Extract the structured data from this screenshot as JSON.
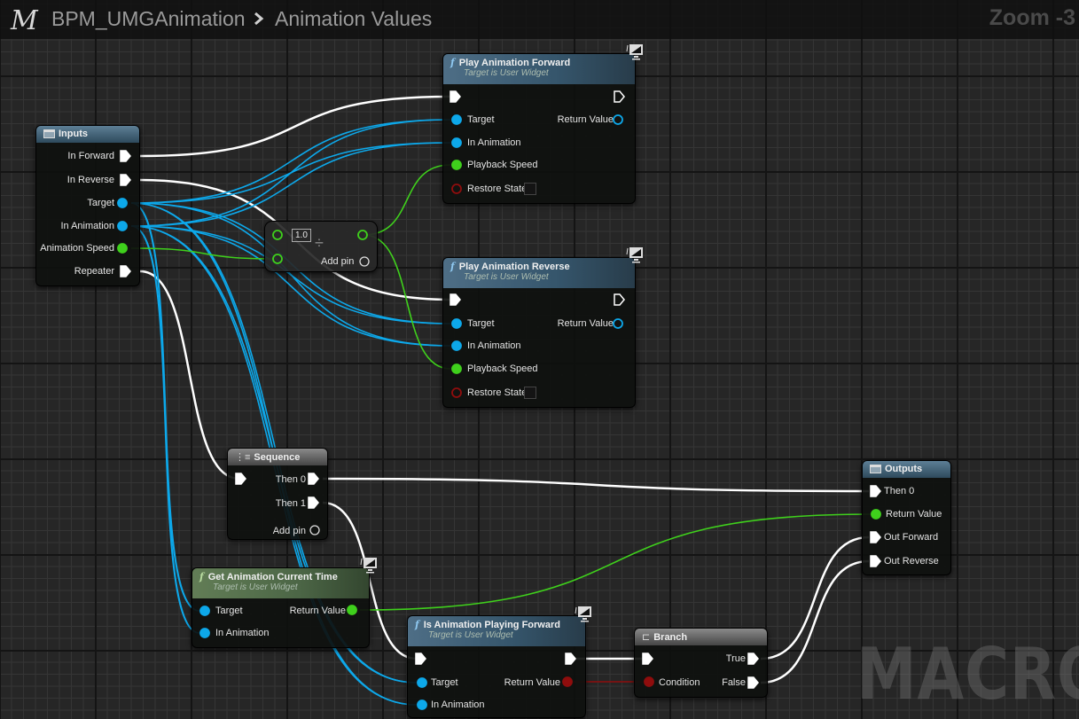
{
  "breadcrumb": {
    "macro_glyph": "M",
    "graph_name": "BPM_UMGAnimation",
    "separator": "chevron-right",
    "current": "Animation Values"
  },
  "zoom_label": "Zoom -3",
  "watermark": "MACRO",
  "colors": {
    "exec": "#ffffff",
    "object": "#0da8ea",
    "float": "#3fd01c",
    "bool": "#8f0d0d",
    "background": "#262626"
  },
  "nodes": {
    "inputs": {
      "title": "Inputs",
      "pins": [
        {
          "label": "In Forward",
          "type": "exec"
        },
        {
          "label": "In Reverse",
          "type": "exec"
        },
        {
          "label": "Target",
          "type": "object"
        },
        {
          "label": "In Animation",
          "type": "object"
        },
        {
          "label": "Animation Speed",
          "type": "float"
        },
        {
          "label": "Repeater",
          "type": "exec"
        }
      ]
    },
    "divide": {
      "symbol": "÷",
      "default_value": "1.0",
      "add_pin": "Add pin"
    },
    "play_forward": {
      "title": "Play Animation Forward",
      "subtitle": "Target is User Widget",
      "inputs": [
        "Target",
        "In Animation",
        "Playback Speed",
        "Restore State"
      ],
      "output": "Return Value"
    },
    "play_reverse": {
      "title": "Play Animation Reverse",
      "subtitle": "Target is User Widget",
      "inputs": [
        "Target",
        "In Animation",
        "Playback Speed",
        "Restore State"
      ],
      "output": "Return Value"
    },
    "sequence": {
      "title": "Sequence",
      "outputs": [
        "Then 0",
        "Then 1"
      ],
      "add_pin": "Add pin"
    },
    "get_time": {
      "title": "Get Animation Current Time",
      "subtitle": "Target is User Widget",
      "inputs": [
        "Target",
        "In Animation"
      ],
      "output": "Return Value"
    },
    "is_playing_forward": {
      "title": "Is Animation Playing Forward",
      "subtitle": "Target is User Widget",
      "inputs": [
        "Target",
        "In Animation"
      ],
      "output": "Return Value"
    },
    "branch": {
      "title": "Branch",
      "input": "Condition",
      "outputs": [
        "True",
        "False"
      ]
    },
    "outputs": {
      "title": "Outputs",
      "pins": [
        "Then 0",
        "Return Value",
        "Out Forward",
        "Out Reverse"
      ]
    }
  }
}
